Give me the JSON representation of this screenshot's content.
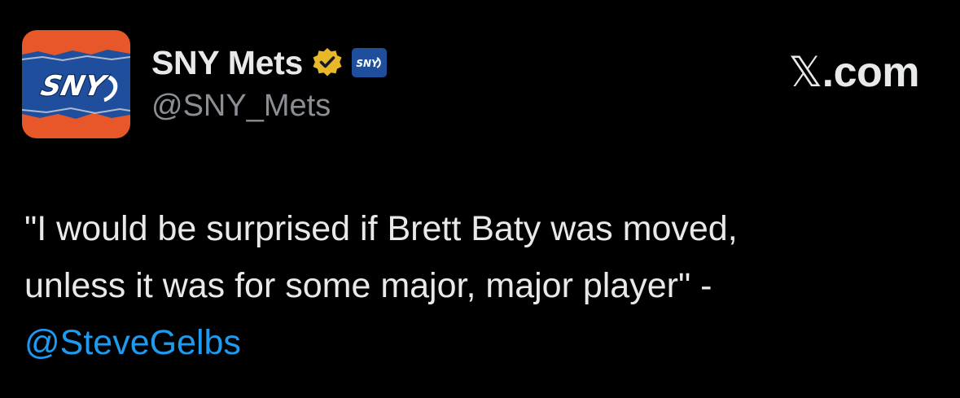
{
  "account": {
    "display_name": "SNY Mets",
    "handle": "@SNY_Mets",
    "avatar_logo": "SNY",
    "affiliate_badge_logo": "SNY"
  },
  "icons": {
    "verified": "verified-gold-badge-icon",
    "affiliate": "sny-affiliate-badge-icon"
  },
  "brand": {
    "x_symbol": "𝕏",
    "suffix": ".com"
  },
  "tweet": {
    "text": "\"I would be surprised if Brett Baty was moved,\nunless it was for some major, major player\" -",
    "mention": "@SteveGelbs"
  },
  "colors": {
    "background": "#000000",
    "text": "#e7e9ea",
    "muted": "#8b8f94",
    "mention": "#1d9bf0",
    "verified_gold": "#e8b829",
    "sny_orange": "#e8572a",
    "sny_blue": "#1f4f9c"
  }
}
